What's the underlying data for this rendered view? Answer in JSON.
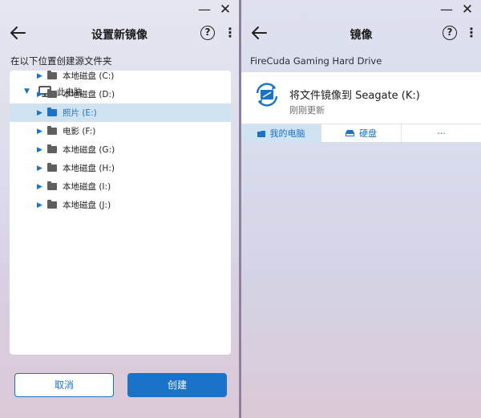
{
  "left": {
    "title": "设置新镜像",
    "subtitle": "在以下位置创建源文件夹",
    "root": {
      "label": "此电脑",
      "icon": "monitor-icon"
    },
    "items": [
      {
        "label": "本地磁盘 (C:)",
        "selected": false
      },
      {
        "label": "本地磁盘 (D:)",
        "selected": false
      },
      {
        "label": "照片 (E:)",
        "selected": true
      },
      {
        "label": "电影 (F:)",
        "selected": false
      },
      {
        "label": "本地磁盘 (G:)",
        "selected": false
      },
      {
        "label": "本地磁盘 (H:)",
        "selected": false
      },
      {
        "label": "本地磁盘 (I:)",
        "selected": false
      },
      {
        "label": "本地磁盘 (J:)",
        "selected": false
      }
    ],
    "cancel_label": "取消",
    "create_label": "创建"
  },
  "right": {
    "title": "镜像",
    "drive_name": "FireCuda Gaming Hard Drive",
    "card": {
      "title": "将文件镜像到 Seagate (K:)",
      "subtitle": "刚刚更新"
    },
    "tabs": [
      {
        "label": "我的电脑",
        "icon": "computer-icon",
        "active": true
      },
      {
        "label": "硬盘",
        "icon": "drive-icon",
        "active": false
      },
      {
        "label": "···",
        "icon": "more-icon",
        "active": false
      }
    ]
  },
  "window_controls": {
    "minimize": "—",
    "close": "✕"
  },
  "header_icons": {
    "help": "?",
    "more": "⋮"
  },
  "colors": {
    "accent": "#1a73c8",
    "selection": "#cfe3f3",
    "folder": "#5f5f5f"
  }
}
